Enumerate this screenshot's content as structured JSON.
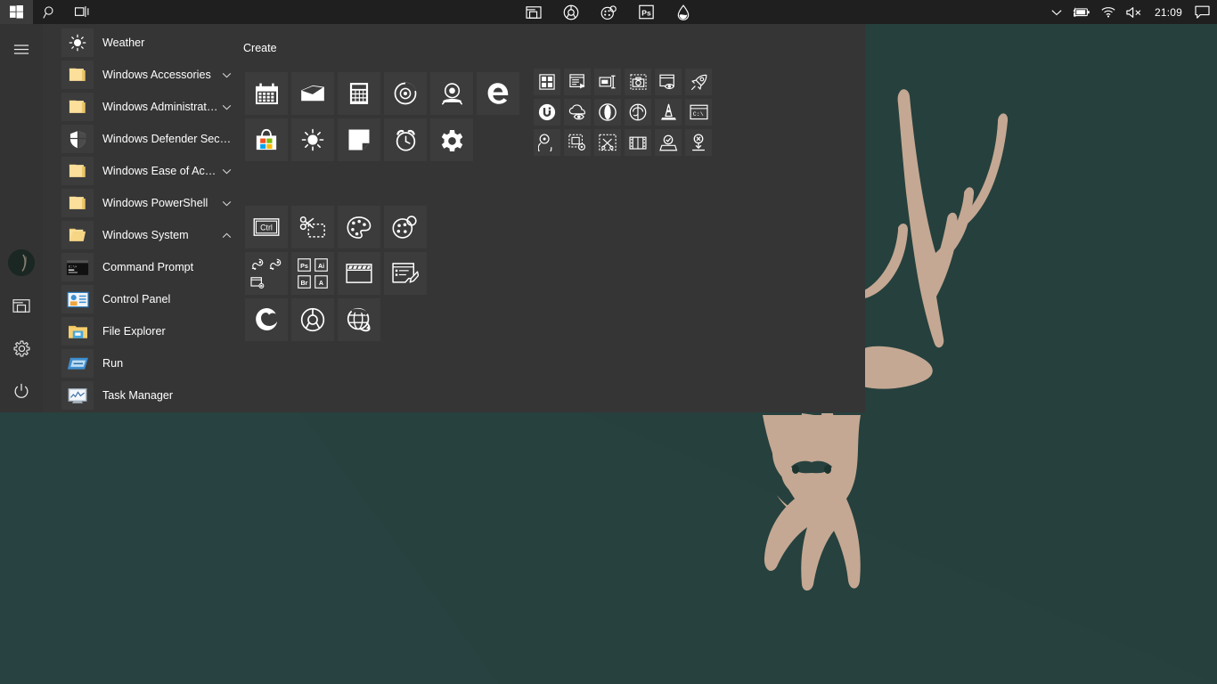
{
  "desktop": {
    "wallpaper": {
      "name": "deer-stag-wallpaper",
      "bg_color": "#27413f",
      "bg_color_dark": "#27403c",
      "figure_color": "#c4a893",
      "description": "Upside-down stag head silhouette with antlers"
    }
  },
  "taskbar": {
    "bg_color": "#1f1f1f",
    "start_button": {
      "label": "Start",
      "icon": "windows-logo-icon",
      "active": true
    },
    "search_button": {
      "label": "Search",
      "icon": "search-icon"
    },
    "taskview_button": {
      "label": "Task View",
      "icon": "task-view-icon"
    },
    "pinned_apps": [
      {
        "label": "File Explorer",
        "icon": "file-explorer-icon"
      },
      {
        "label": "Google Chrome",
        "icon": "chrome-icon"
      },
      {
        "label": "Paint 3D",
        "icon": "paint3d-icon"
      },
      {
        "label": "Adobe Photoshop",
        "icon": "photoshop-icon"
      },
      {
        "label": "Water Drop App",
        "icon": "water-drop-icon"
      }
    ],
    "tray": {
      "show_hidden": {
        "label": "Show hidden icons",
        "icon": "chevron-up-icon"
      },
      "battery": {
        "label": "Battery charging",
        "icon": "battery-charging-icon"
      },
      "network": {
        "label": "Network",
        "icon": "wifi-icon"
      },
      "volume": {
        "label": "Volume muted",
        "icon": "speaker-muted-icon"
      },
      "clock": {
        "time": "21:09"
      },
      "action_center": {
        "label": "Action Center",
        "icon": "action-center-icon"
      }
    }
  },
  "start_menu": {
    "bg_color": "#353535",
    "rail": {
      "top": [
        {
          "name": "hamburger",
          "label": "Expand",
          "icon": "hamburger-icon"
        }
      ],
      "bottom": [
        {
          "name": "user",
          "label": "User account",
          "icon": "avatar-icon"
        },
        {
          "name": "documents",
          "label": "Documents",
          "icon": "documents-icon"
        },
        {
          "name": "settings",
          "label": "Settings",
          "icon": "gear-icon"
        },
        {
          "name": "power",
          "label": "Power",
          "icon": "power-icon"
        }
      ]
    },
    "app_list": [
      {
        "label": "Weather",
        "icon": "weather-sun-icon",
        "type": "app",
        "expandable": false
      },
      {
        "label": "Windows Accessories",
        "icon": "folder-icon",
        "type": "folder",
        "expandable": true,
        "expanded": false
      },
      {
        "label": "Windows Administrative Tools",
        "icon": "folder-icon",
        "type": "folder",
        "expandable": true,
        "expanded": false
      },
      {
        "label": "Windows Defender Security Centre",
        "icon": "shield-icon",
        "type": "app",
        "expandable": false
      },
      {
        "label": "Windows Ease of Access",
        "icon": "folder-icon",
        "type": "folder",
        "expandable": true,
        "expanded": false
      },
      {
        "label": "Windows PowerShell",
        "icon": "folder-icon",
        "type": "folder",
        "expandable": true,
        "expanded": false
      },
      {
        "label": "Windows System",
        "icon": "folder-open-icon",
        "type": "folder",
        "expandable": true,
        "expanded": true
      },
      {
        "label": "Command Prompt",
        "icon": "command-prompt-icon",
        "type": "app",
        "expandable": false,
        "indent": true
      },
      {
        "label": "Control Panel",
        "icon": "control-panel-icon",
        "type": "app",
        "expandable": false,
        "indent": true
      },
      {
        "label": "File Explorer",
        "icon": "file-explorer-icon",
        "type": "app",
        "expandable": false,
        "indent": true
      },
      {
        "label": "Run",
        "icon": "run-icon",
        "type": "app",
        "expandable": false,
        "indent": true
      },
      {
        "label": "Task Manager",
        "icon": "task-manager-icon",
        "type": "app",
        "expandable": false,
        "indent": true
      }
    ],
    "tile_groups": [
      {
        "title": "Create",
        "tiles": [
          {
            "label": "Calendar",
            "icon": "calendar-icon"
          },
          {
            "label": "Mail",
            "icon": "mail-icon"
          },
          {
            "label": "Calculator",
            "icon": "calculator-icon"
          },
          {
            "label": "Groove Music",
            "icon": "groove-music-icon"
          },
          {
            "label": "Camera",
            "icon": "camera-icon"
          },
          {
            "label": "Microsoft Edge",
            "icon": "edge-icon"
          },
          {
            "label": "Microsoft Store",
            "icon": "store-icon"
          },
          {
            "label": "Weather",
            "icon": "weather-sun-icon"
          },
          {
            "label": "Sticky Notes",
            "icon": "sticky-notes-icon"
          },
          {
            "label": "Alarms & Clock",
            "icon": "alarm-clock-icon"
          },
          {
            "label": "Settings",
            "icon": "gear-icon"
          }
        ]
      },
      {
        "title": "",
        "tiles": [
          {
            "label": "Dashboard",
            "icon": "grid-tiles-icon"
          },
          {
            "label": "Media Player",
            "icon": "playlist-play-icon"
          },
          {
            "label": "Text Tool",
            "icon": "text-label-icon"
          },
          {
            "label": "Screenshot",
            "icon": "screen-capture-icon"
          },
          {
            "label": "Preview",
            "icon": "window-eye-icon"
          },
          {
            "label": "Launcher",
            "icon": "rocket-icon"
          },
          {
            "label": "uTorrent",
            "icon": "utorrent-icon"
          },
          {
            "label": "Cloud Viewer",
            "icon": "cloud-eye-icon"
          },
          {
            "label": "Opera",
            "icon": "opera-icon"
          },
          {
            "label": "Brain Tool",
            "icon": "brain-icon"
          },
          {
            "label": "VLC Media Player",
            "icon": "vlc-cone-icon"
          },
          {
            "label": "Command Prompt",
            "icon": "cmd-window-icon"
          },
          {
            "label": "Disc Burner",
            "icon": "disc-icon"
          },
          {
            "label": "Video Settings",
            "icon": "film-gear-icon"
          },
          {
            "label": "Video Cutter",
            "icon": "film-cut-icon"
          },
          {
            "label": "Split View",
            "icon": "film-strip-icon"
          },
          {
            "label": "Scanner",
            "icon": "scanner-check-icon"
          },
          {
            "label": "Uninstaller",
            "icon": "remove-download-icon"
          }
        ]
      },
      {
        "title": "",
        "tiles": [
          {
            "label": "Remote Control",
            "icon": "ctrl-key-icon"
          },
          {
            "label": "Snipping Tool",
            "icon": "scissors-snip-icon"
          },
          {
            "label": "Paint",
            "icon": "paint-palette-icon"
          },
          {
            "label": "Paint 3D",
            "icon": "paint3d-icon"
          },
          {
            "label": "Tools Folder",
            "icon": "folder-group-tools-icon",
            "sub_icons": [
              "tool-a-icon",
              "tool-b-icon",
              "tool-c-icon"
            ]
          },
          {
            "label": "Adobe Folder",
            "icon": "folder-group-adobe-icon",
            "sub_icons": [
              "Ps",
              "Ai",
              "Br",
              "A"
            ]
          },
          {
            "label": "Movie Maker",
            "icon": "movie-maker-icon"
          },
          {
            "label": "WordPad",
            "icon": "wordpad-icon"
          },
          {
            "label": "Mozilla Firefox",
            "icon": "firefox-icon"
          },
          {
            "label": "Google Chrome",
            "icon": "chrome-icon"
          },
          {
            "label": "Internet Explorer",
            "icon": "internet-explorer-icon"
          }
        ]
      }
    ]
  }
}
